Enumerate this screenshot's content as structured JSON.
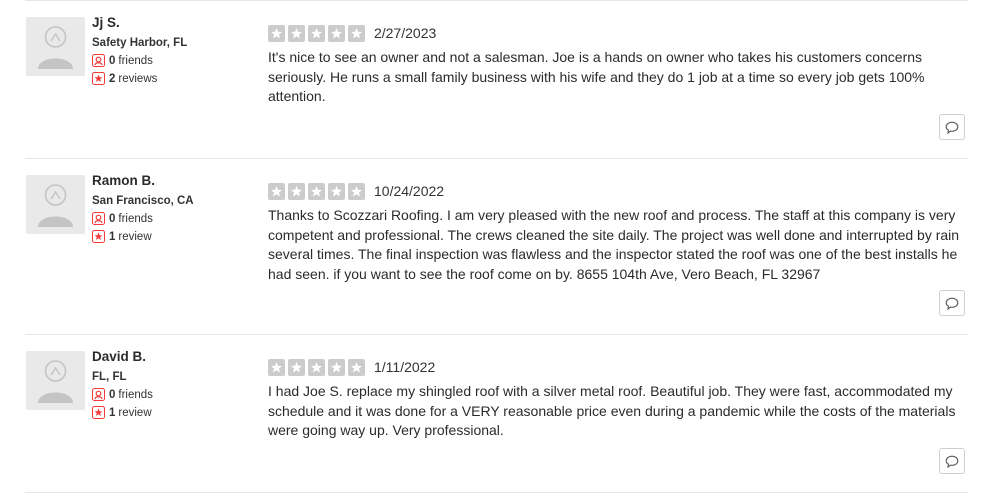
{
  "reviews": [
    {
      "user": {
        "name": "Jj S.",
        "location": "Safety Harbor, FL",
        "friends_count": "0",
        "friends_label": "friends",
        "reviews_count": "2",
        "reviews_label": "reviews"
      },
      "rating": 5,
      "date": "2/27/2023",
      "text": "It's nice to see an owner and not a salesman. Joe is a hands on owner who takes his customers concerns seriously. He runs a small family business with his wife and they do 1 job at a time so every job gets 100% attention."
    },
    {
      "user": {
        "name": "Ramon B.",
        "location": "San Francisco, CA",
        "friends_count": "0",
        "friends_label": "friends",
        "reviews_count": "1",
        "reviews_label": "review"
      },
      "rating": 5,
      "date": "10/24/2022",
      "text": "Thanks to Scozzari Roofing.  I am very pleased with the new roof and process.  The staff at this company is very competent and professional.  The crews cleaned the site daily.  The project was well done and interrupted by rain several times. The final inspection was flawless and the inspector stated the roof was one of the best installs he had seen.  if you want to see the roof come on by.  8655 104th Ave, Vero Beach, FL 32967"
    },
    {
      "user": {
        "name": "David B.",
        "location": "FL, FL",
        "friends_count": "0",
        "friends_label": "friends",
        "reviews_count": "1",
        "reviews_label": "review"
      },
      "rating": 5,
      "date": "1/11/2022",
      "text": "I had Joe S. replace my shingled roof with a silver metal roof.  Beautiful job.  They were fast, accommodated my schedule and it was done for a VERY reasonable price even during a pandemic while the costs of the materials were going way up. Very professional."
    }
  ],
  "icons": {
    "friends": "friends-icon",
    "reviews": "reviews-star-icon",
    "comment": "comment-bubble-icon",
    "avatar": "default-avatar-icon"
  },
  "colors": {
    "icon_accent": "#f43939",
    "star_empty": "#cccccc",
    "divider": "#e6e6e6"
  }
}
